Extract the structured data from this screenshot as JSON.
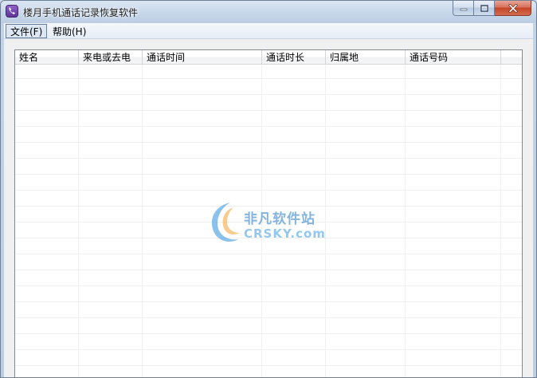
{
  "window": {
    "title": "楼月手机通话记录恢复软件"
  },
  "caption": {
    "minimize_icon": "minimize-icon",
    "maximize_icon": "maximize-icon",
    "close_icon": "close-icon"
  },
  "menu": {
    "file": "文件(F)",
    "help": "帮助(H)"
  },
  "table": {
    "columns": [
      "姓名",
      "来电或去电",
      "通话时间",
      "通话时长",
      "归属地",
      "通话号码"
    ]
  },
  "watermark": {
    "cn": "非凡软件站",
    "en": "CRSKY.com"
  },
  "colors": {
    "accent": "#1e78c8",
    "close_button": "#c44525"
  }
}
